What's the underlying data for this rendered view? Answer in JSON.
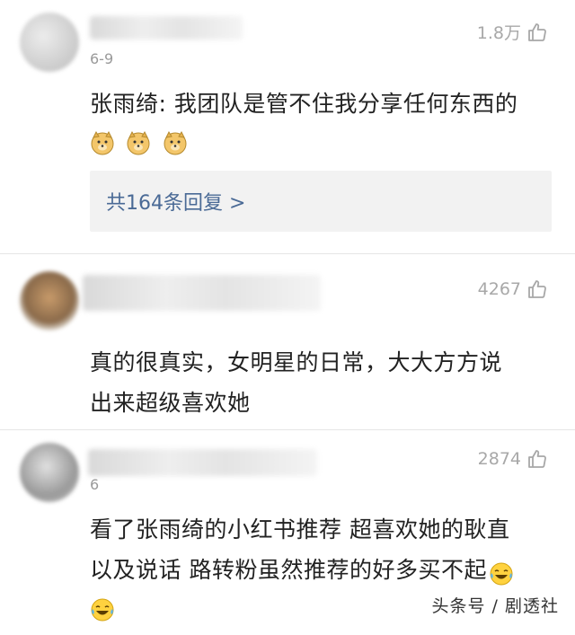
{
  "comments": [
    {
      "date": "6-9",
      "likes": "1.8万",
      "text": "张雨绮: 我团队是管不住我分享任何东西的",
      "emoji_count": 3,
      "reply_label": "共164条回复 >"
    },
    {
      "likes": "4267",
      "text_line1": "真的很真实，女明星的日常，大大方方说",
      "text_line2": "出来超级喜欢她"
    },
    {
      "date": "6",
      "likes": "2874",
      "text_line1": "看了张雨绮的小红书推荐  超喜欢她的耿直",
      "text_line2": "以及说话  路转粉虽然推荐的好多买不起"
    }
  ],
  "watermark": "头条号 / 剧透社",
  "colors": {
    "link": "#4a6a96",
    "muted": "#9a9a9a",
    "reply_bg": "#f2f2f2"
  },
  "icons": [
    "thumbs-up-icon",
    "doge-emoji-icon",
    "laughing-tears-emoji-icon"
  ]
}
